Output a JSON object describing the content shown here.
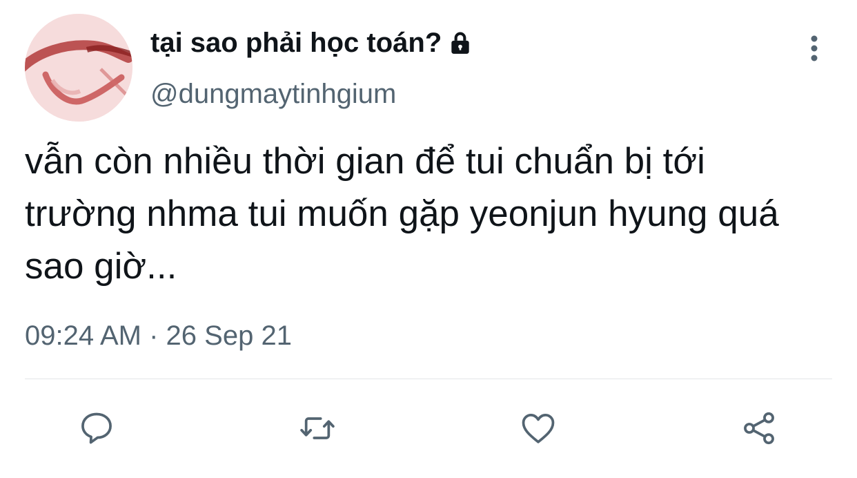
{
  "author": {
    "display_name": "tại sao phải học toán?",
    "handle": "@dungmaytinhgium",
    "protected_icon": "lock-icon",
    "avatar_icon": "avatar-image"
  },
  "tweet": {
    "text": "vẫn còn nhiều thời gian để tui chuẩn bị tới trường nhma tui muốn gặp yeonjun hyung quá sao giờ...",
    "timestamp": "09:24 AM · 26 Sep 21"
  },
  "actions": [
    {
      "name": "reply",
      "icon": "comment-icon"
    },
    {
      "name": "retweet",
      "icon": "retweet-icon"
    },
    {
      "name": "like",
      "icon": "heart-icon"
    },
    {
      "name": "share",
      "icon": "share-icon"
    }
  ],
  "menu_icon": "more-vertical-icon",
  "colors": {
    "text_primary": "#0f1419",
    "text_secondary": "#536471",
    "icon": "#536471",
    "divider": "#e3e6e8"
  }
}
